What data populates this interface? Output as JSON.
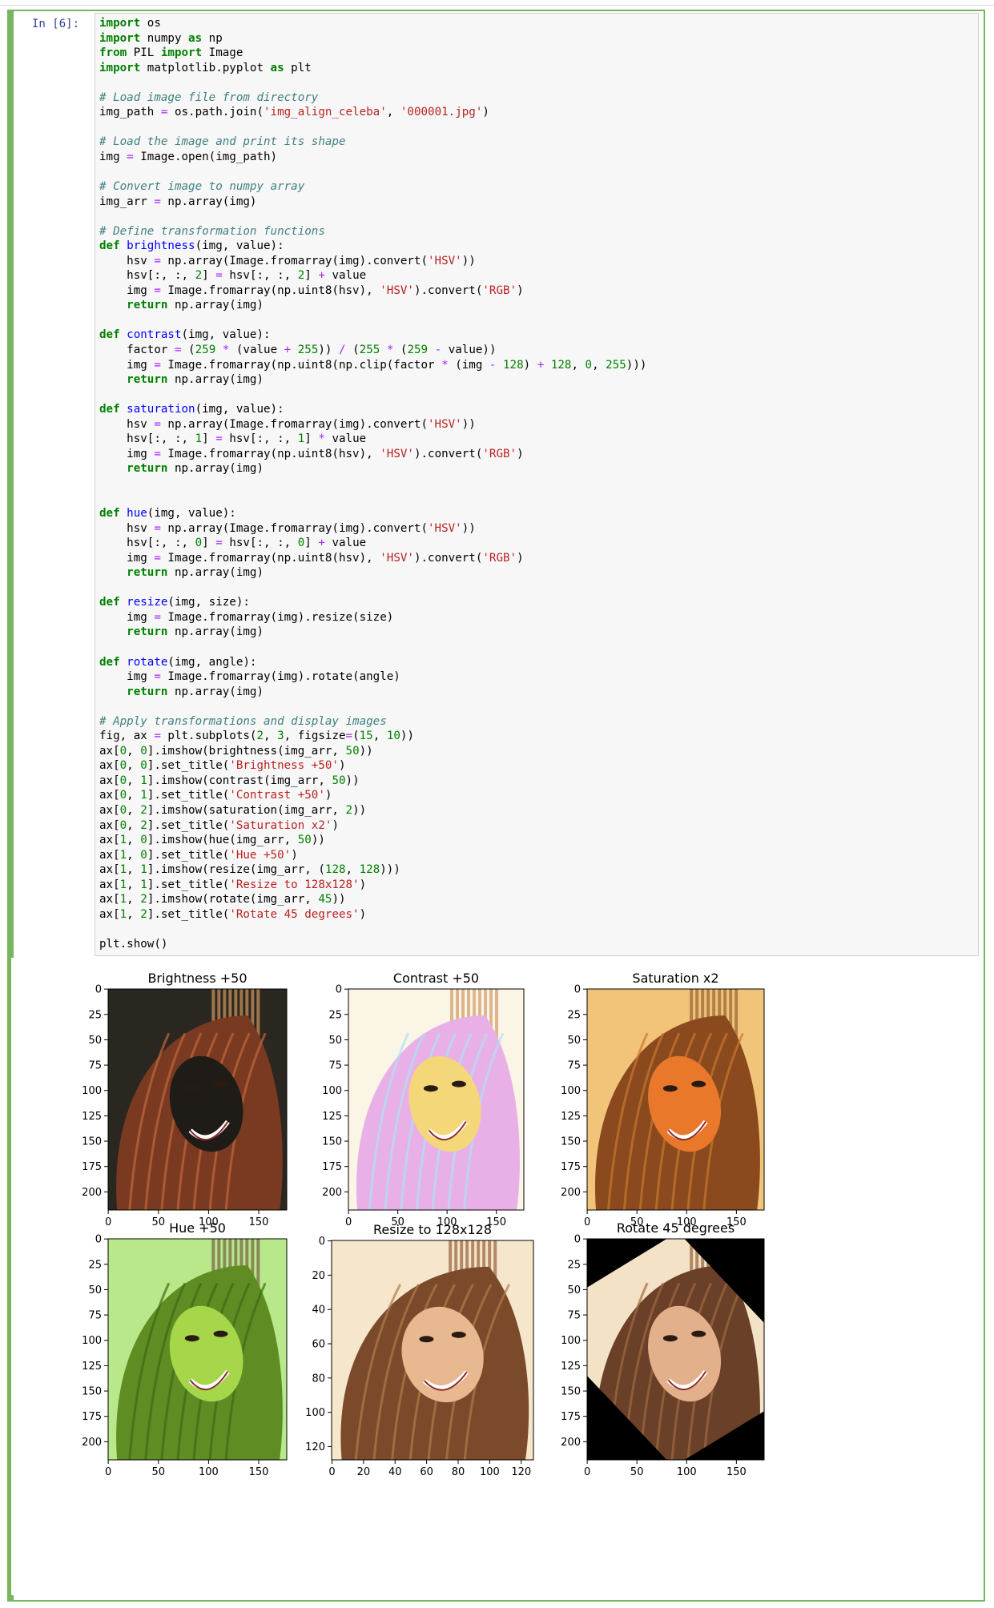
{
  "notebook": {
    "prompt": "In [6]:"
  },
  "code_lines": [
    [
      [
        "kw",
        "import"
      ],
      [
        "t",
        " os"
      ]
    ],
    [
      [
        "kw",
        "import"
      ],
      [
        "t",
        " numpy "
      ],
      [
        "kw",
        "as"
      ],
      [
        "t",
        " np"
      ]
    ],
    [
      [
        "kw",
        "from"
      ],
      [
        "t",
        " PIL "
      ],
      [
        "kw",
        "import"
      ],
      [
        "t",
        " Image"
      ]
    ],
    [
      [
        "kw",
        "import"
      ],
      [
        "t",
        " matplotlib.pyplot "
      ],
      [
        "kw",
        "as"
      ],
      [
        "t",
        " plt"
      ]
    ],
    [],
    [
      [
        "cm",
        "# Load image file from directory"
      ]
    ],
    [
      [
        "t",
        "img_path "
      ],
      [
        "op",
        "="
      ],
      [
        "t",
        " os.path.join("
      ],
      [
        "st",
        "'img_align_celeba'"
      ],
      [
        "t",
        ", "
      ],
      [
        "st",
        "'000001.jpg'"
      ],
      [
        "t",
        ")"
      ]
    ],
    [],
    [
      [
        "cm",
        "# Load the image and print its shape"
      ]
    ],
    [
      [
        "t",
        "img "
      ],
      [
        "op",
        "="
      ],
      [
        "t",
        " Image.open(img_path)"
      ]
    ],
    [],
    [
      [
        "cm",
        "# Convert image to numpy array"
      ]
    ],
    [
      [
        "t",
        "img_arr "
      ],
      [
        "op",
        "="
      ],
      [
        "t",
        " np.array(img)"
      ]
    ],
    [],
    [
      [
        "cm",
        "# Define transformation functions"
      ]
    ],
    [
      [
        "kw",
        "def"
      ],
      [
        "t",
        " "
      ],
      [
        "fn",
        "brightness"
      ],
      [
        "t",
        "(img, value):"
      ]
    ],
    [
      [
        "t",
        "    hsv "
      ],
      [
        "op",
        "="
      ],
      [
        "t",
        " np.array(Image.fromarray(img).convert("
      ],
      [
        "st",
        "'HSV'"
      ],
      [
        "t",
        "))"
      ]
    ],
    [
      [
        "t",
        "    hsv[:, :, "
      ],
      [
        "nu",
        "2"
      ],
      [
        "t",
        "] "
      ],
      [
        "op",
        "="
      ],
      [
        "t",
        " hsv[:, :, "
      ],
      [
        "nu",
        "2"
      ],
      [
        "t",
        "] "
      ],
      [
        "op",
        "+"
      ],
      [
        "t",
        " value"
      ]
    ],
    [
      [
        "t",
        "    img "
      ],
      [
        "op",
        "="
      ],
      [
        "t",
        " Image.fromarray(np.uint8(hsv), "
      ],
      [
        "st",
        "'HSV'"
      ],
      [
        "t",
        ").convert("
      ],
      [
        "st",
        "'RGB'"
      ],
      [
        "t",
        ")"
      ]
    ],
    [
      [
        "t",
        "    "
      ],
      [
        "kw",
        "return"
      ],
      [
        "t",
        " np.array(img)"
      ]
    ],
    [],
    [
      [
        "kw",
        "def"
      ],
      [
        "t",
        " "
      ],
      [
        "fn",
        "contrast"
      ],
      [
        "t",
        "(img, value):"
      ]
    ],
    [
      [
        "t",
        "    factor "
      ],
      [
        "op",
        "="
      ],
      [
        "t",
        " ("
      ],
      [
        "nu",
        "259"
      ],
      [
        "t",
        " "
      ],
      [
        "op",
        "*"
      ],
      [
        "t",
        " (value "
      ],
      [
        "op",
        "+"
      ],
      [
        "t",
        " "
      ],
      [
        "nu",
        "255"
      ],
      [
        "t",
        ")) "
      ],
      [
        "op",
        "/"
      ],
      [
        "t",
        " ("
      ],
      [
        "nu",
        "255"
      ],
      [
        "t",
        " "
      ],
      [
        "op",
        "*"
      ],
      [
        "t",
        " ("
      ],
      [
        "nu",
        "259"
      ],
      [
        "t",
        " "
      ],
      [
        "op",
        "-"
      ],
      [
        "t",
        " value))"
      ]
    ],
    [
      [
        "t",
        "    img "
      ],
      [
        "op",
        "="
      ],
      [
        "t",
        " Image.fromarray(np.uint8(np.clip(factor "
      ],
      [
        "op",
        "*"
      ],
      [
        "t",
        " (img "
      ],
      [
        "op",
        "-"
      ],
      [
        "t",
        " "
      ],
      [
        "nu",
        "128"
      ],
      [
        "t",
        ") "
      ],
      [
        "op",
        "+"
      ],
      [
        "t",
        " "
      ],
      [
        "nu",
        "128"
      ],
      [
        "t",
        ", "
      ],
      [
        "nu",
        "0"
      ],
      [
        "t",
        ", "
      ],
      [
        "nu",
        "255"
      ],
      [
        "t",
        ")))"
      ]
    ],
    [
      [
        "t",
        "    "
      ],
      [
        "kw",
        "return"
      ],
      [
        "t",
        " np.array(img)"
      ]
    ],
    [],
    [
      [
        "kw",
        "def"
      ],
      [
        "t",
        " "
      ],
      [
        "fn",
        "saturation"
      ],
      [
        "t",
        "(img, value):"
      ]
    ],
    [
      [
        "t",
        "    hsv "
      ],
      [
        "op",
        "="
      ],
      [
        "t",
        " np.array(Image.fromarray(img).convert("
      ],
      [
        "st",
        "'HSV'"
      ],
      [
        "t",
        "))"
      ]
    ],
    [
      [
        "t",
        "    hsv[:, :, "
      ],
      [
        "nu",
        "1"
      ],
      [
        "t",
        "] "
      ],
      [
        "op",
        "="
      ],
      [
        "t",
        " hsv[:, :, "
      ],
      [
        "nu",
        "1"
      ],
      [
        "t",
        "] "
      ],
      [
        "op",
        "*"
      ],
      [
        "t",
        " value"
      ]
    ],
    [
      [
        "t",
        "    img "
      ],
      [
        "op",
        "="
      ],
      [
        "t",
        " Image.fromarray(np.uint8(hsv), "
      ],
      [
        "st",
        "'HSV'"
      ],
      [
        "t",
        ").convert("
      ],
      [
        "st",
        "'RGB'"
      ],
      [
        "t",
        ")"
      ]
    ],
    [
      [
        "t",
        "    "
      ],
      [
        "kw",
        "return"
      ],
      [
        "t",
        " np.array(img)"
      ]
    ],
    [],
    [],
    [
      [
        "kw",
        "def"
      ],
      [
        "t",
        " "
      ],
      [
        "fn",
        "hue"
      ],
      [
        "t",
        "(img, value):"
      ]
    ],
    [
      [
        "t",
        "    hsv "
      ],
      [
        "op",
        "="
      ],
      [
        "t",
        " np.array(Image.fromarray(img).convert("
      ],
      [
        "st",
        "'HSV'"
      ],
      [
        "t",
        "))"
      ]
    ],
    [
      [
        "t",
        "    hsv[:, :, "
      ],
      [
        "nu",
        "0"
      ],
      [
        "t",
        "] "
      ],
      [
        "op",
        "="
      ],
      [
        "t",
        " hsv[:, :, "
      ],
      [
        "nu",
        "0"
      ],
      [
        "t",
        "] "
      ],
      [
        "op",
        "+"
      ],
      [
        "t",
        " value"
      ]
    ],
    [
      [
        "t",
        "    img "
      ],
      [
        "op",
        "="
      ],
      [
        "t",
        " Image.fromarray(np.uint8(hsv), "
      ],
      [
        "st",
        "'HSV'"
      ],
      [
        "t",
        ").convert("
      ],
      [
        "st",
        "'RGB'"
      ],
      [
        "t",
        ")"
      ]
    ],
    [
      [
        "t",
        "    "
      ],
      [
        "kw",
        "return"
      ],
      [
        "t",
        " np.array(img)"
      ]
    ],
    [],
    [
      [
        "kw",
        "def"
      ],
      [
        "t",
        " "
      ],
      [
        "fn",
        "resize"
      ],
      [
        "t",
        "(img, size):"
      ]
    ],
    [
      [
        "t",
        "    img "
      ],
      [
        "op",
        "="
      ],
      [
        "t",
        " Image.fromarray(img).resize(size)"
      ]
    ],
    [
      [
        "t",
        "    "
      ],
      [
        "kw",
        "return"
      ],
      [
        "t",
        " np.array(img)"
      ]
    ],
    [],
    [
      [
        "kw",
        "def"
      ],
      [
        "t",
        " "
      ],
      [
        "fn",
        "rotate"
      ],
      [
        "t",
        "(img, angle):"
      ]
    ],
    [
      [
        "t",
        "    img "
      ],
      [
        "op",
        "="
      ],
      [
        "t",
        " Image.fromarray(img).rotate(angle)"
      ]
    ],
    [
      [
        "t",
        "    "
      ],
      [
        "kw",
        "return"
      ],
      [
        "t",
        " np.array(img)"
      ]
    ],
    [],
    [
      [
        "cm",
        "# Apply transformations and display images"
      ]
    ],
    [
      [
        "t",
        "fig, ax "
      ],
      [
        "op",
        "="
      ],
      [
        "t",
        " plt.subplots("
      ],
      [
        "nu",
        "2"
      ],
      [
        "t",
        ", "
      ],
      [
        "nu",
        "3"
      ],
      [
        "t",
        ", figsize"
      ],
      [
        "op",
        "="
      ],
      [
        "t",
        "("
      ],
      [
        "nu",
        "15"
      ],
      [
        "t",
        ", "
      ],
      [
        "nu",
        "10"
      ],
      [
        "t",
        "))"
      ]
    ],
    [
      [
        "t",
        "ax["
      ],
      [
        "nu",
        "0"
      ],
      [
        "t",
        ", "
      ],
      [
        "nu",
        "0"
      ],
      [
        "t",
        "].imshow(brightness(img_arr, "
      ],
      [
        "nu",
        "50"
      ],
      [
        "t",
        "))"
      ]
    ],
    [
      [
        "t",
        "ax["
      ],
      [
        "nu",
        "0"
      ],
      [
        "t",
        ", "
      ],
      [
        "nu",
        "0"
      ],
      [
        "t",
        "].set_title("
      ],
      [
        "st",
        "'Brightness +50'"
      ],
      [
        "t",
        ")"
      ]
    ],
    [
      [
        "t",
        "ax["
      ],
      [
        "nu",
        "0"
      ],
      [
        "t",
        ", "
      ],
      [
        "nu",
        "1"
      ],
      [
        "t",
        "].imshow(contrast(img_arr, "
      ],
      [
        "nu",
        "50"
      ],
      [
        "t",
        "))"
      ]
    ],
    [
      [
        "t",
        "ax["
      ],
      [
        "nu",
        "0"
      ],
      [
        "t",
        ", "
      ],
      [
        "nu",
        "1"
      ],
      [
        "t",
        "].set_title("
      ],
      [
        "st",
        "'Contrast +50'"
      ],
      [
        "t",
        ")"
      ]
    ],
    [
      [
        "t",
        "ax["
      ],
      [
        "nu",
        "0"
      ],
      [
        "t",
        ", "
      ],
      [
        "nu",
        "2"
      ],
      [
        "t",
        "].imshow(saturation(img_arr, "
      ],
      [
        "nu",
        "2"
      ],
      [
        "t",
        "))"
      ]
    ],
    [
      [
        "t",
        "ax["
      ],
      [
        "nu",
        "0"
      ],
      [
        "t",
        ", "
      ],
      [
        "nu",
        "2"
      ],
      [
        "t",
        "].set_title("
      ],
      [
        "st",
        "'Saturation x2'"
      ],
      [
        "t",
        ")"
      ]
    ],
    [
      [
        "t",
        "ax["
      ],
      [
        "nu",
        "1"
      ],
      [
        "t",
        ", "
      ],
      [
        "nu",
        "0"
      ],
      [
        "t",
        "].imshow(hue(img_arr, "
      ],
      [
        "nu",
        "50"
      ],
      [
        "t",
        "))"
      ]
    ],
    [
      [
        "t",
        "ax["
      ],
      [
        "nu",
        "1"
      ],
      [
        "t",
        ", "
      ],
      [
        "nu",
        "0"
      ],
      [
        "t",
        "].set_title("
      ],
      [
        "st",
        "'Hue +50'"
      ],
      [
        "t",
        ")"
      ]
    ],
    [
      [
        "t",
        "ax["
      ],
      [
        "nu",
        "1"
      ],
      [
        "t",
        ", "
      ],
      [
        "nu",
        "1"
      ],
      [
        "t",
        "].imshow(resize(img_arr, ("
      ],
      [
        "nu",
        "128"
      ],
      [
        "t",
        ", "
      ],
      [
        "nu",
        "128"
      ],
      [
        "t",
        ")))"
      ]
    ],
    [
      [
        "t",
        "ax["
      ],
      [
        "nu",
        "1"
      ],
      [
        "t",
        ", "
      ],
      [
        "nu",
        "1"
      ],
      [
        "t",
        "].set_title("
      ],
      [
        "st",
        "'Resize to 128x128'"
      ],
      [
        "t",
        ")"
      ]
    ],
    [
      [
        "t",
        "ax["
      ],
      [
        "nu",
        "1"
      ],
      [
        "t",
        ", "
      ],
      [
        "nu",
        "2"
      ],
      [
        "t",
        "].imshow(rotate(img_arr, "
      ],
      [
        "nu",
        "45"
      ],
      [
        "t",
        "))"
      ]
    ],
    [
      [
        "t",
        "ax["
      ],
      [
        "nu",
        "1"
      ],
      [
        "t",
        ", "
      ],
      [
        "nu",
        "2"
      ],
      [
        "t",
        "].set_title("
      ],
      [
        "st",
        "'Rotate 45 degrees'"
      ],
      [
        "t",
        ")"
      ]
    ],
    [],
    [
      [
        "t",
        "plt.show()"
      ]
    ]
  ],
  "figure": {
    "panels": [
      {
        "title": "Brightness +50",
        "transform": "brightness",
        "xticks": [
          "0",
          "50",
          "100",
          "150"
        ],
        "yticks": [
          "0",
          "25",
          "50",
          "75",
          "100",
          "125",
          "150",
          "175",
          "200"
        ],
        "tint": "#2a2620"
      },
      {
        "title": "Contrast +50",
        "transform": "contrast",
        "xticks": [
          "0",
          "50",
          "100",
          "150"
        ],
        "yticks": [
          "0",
          "25",
          "50",
          "75",
          "100",
          "125",
          "150",
          "175",
          "200"
        ],
        "tint": "#fbf5e6"
      },
      {
        "title": "Saturation x2",
        "transform": "saturation",
        "xticks": [
          "0",
          "50",
          "100",
          "150"
        ],
        "yticks": [
          "0",
          "25",
          "50",
          "75",
          "100",
          "125",
          "150",
          "175",
          "200"
        ],
        "tint": "#f2c47a"
      },
      {
        "title": "Hue +50",
        "transform": "hue",
        "xticks": [
          "0",
          "50",
          "100",
          "150"
        ],
        "yticks": [
          "0",
          "25",
          "50",
          "75",
          "100",
          "125",
          "150",
          "175",
          "200"
        ],
        "tint": "#b8e88a"
      },
      {
        "title": "Resize to 128x128",
        "transform": "resize",
        "xticks": [
          "0",
          "20",
          "40",
          "60",
          "80",
          "100",
          "120"
        ],
        "yticks": [
          "0",
          "20",
          "40",
          "60",
          "80",
          "100",
          "120"
        ],
        "tint": "#f6e6cc"
      },
      {
        "title": "Rotate 45 degrees",
        "transform": "rotate",
        "xticks": [
          "0",
          "50",
          "100",
          "150"
        ],
        "yticks": [
          "0",
          "25",
          "50",
          "75",
          "100",
          "125",
          "150",
          "175",
          "200"
        ],
        "tint": "#000000"
      }
    ]
  }
}
